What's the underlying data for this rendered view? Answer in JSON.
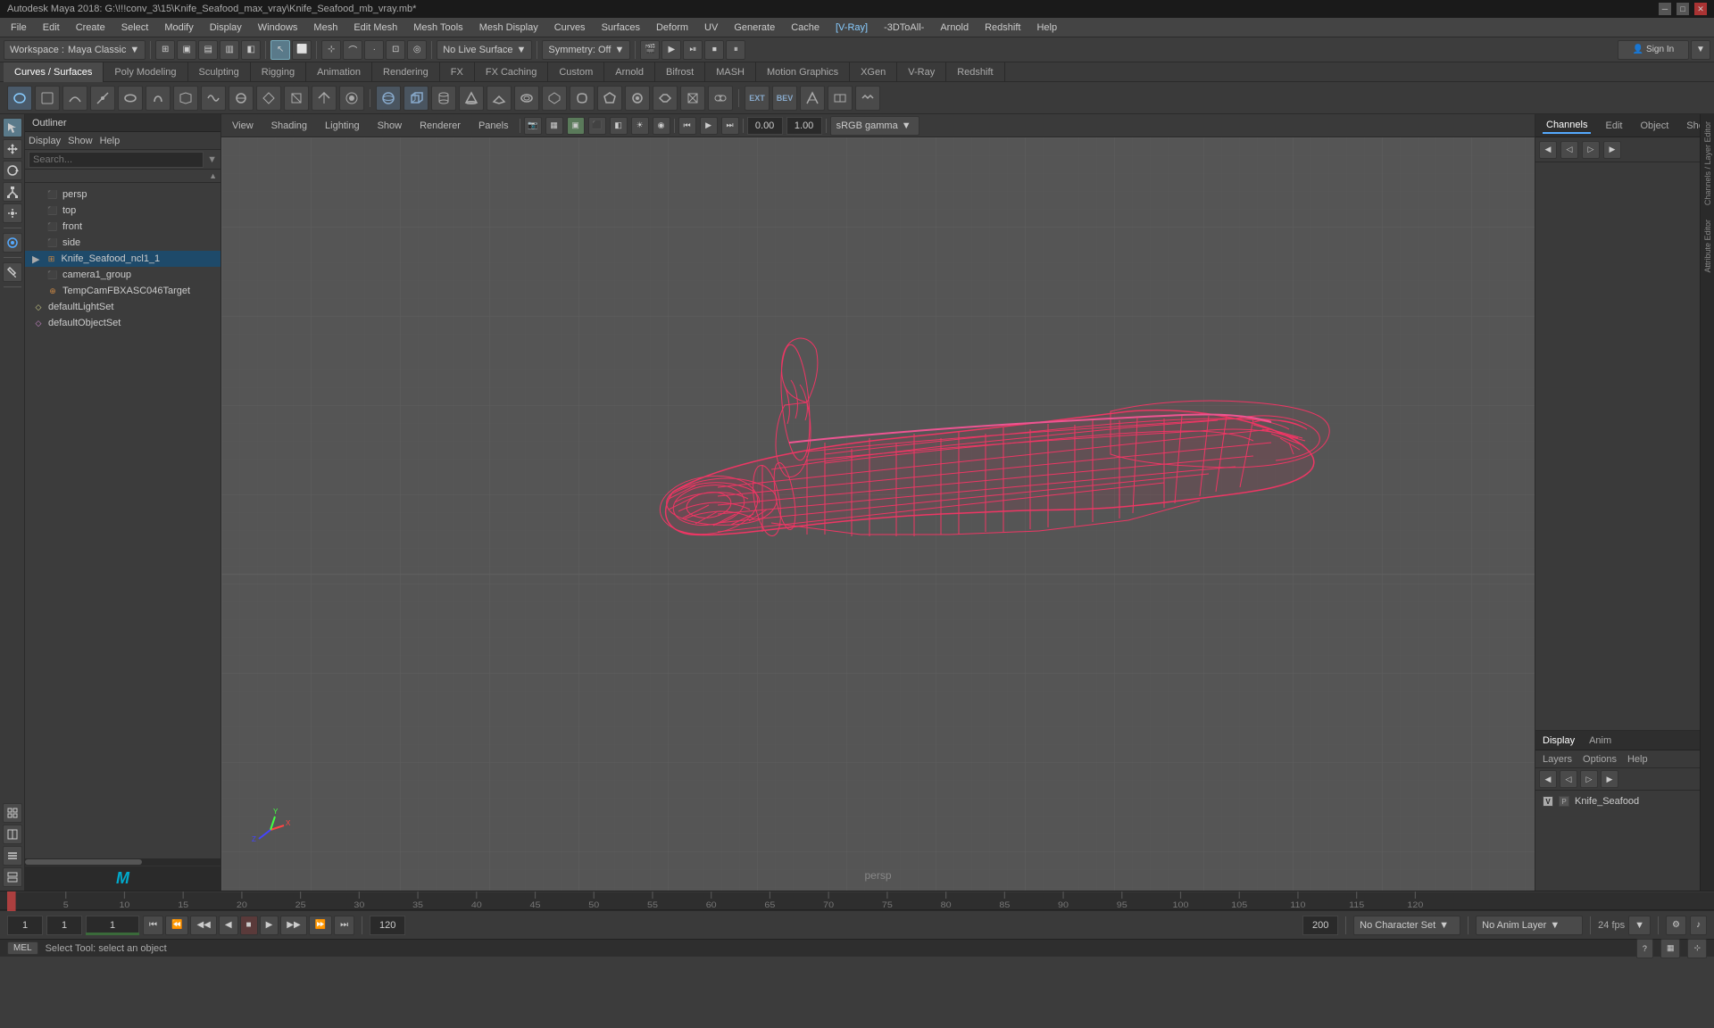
{
  "window": {
    "title": "Autodesk Maya 2018: G:\\!!!conv_3\\15\\Knife_Seafood_max_vray\\Knife_Seafood_mb_vray.mb*",
    "title_short": "Autodesk Maya 2018: G:\\!!!conv_3\\15\\Knife_Seafood_max_vray\\Knife_Seafood_mb_vray.mb*"
  },
  "menu_bar": {
    "items": [
      "File",
      "Edit",
      "Create",
      "Select",
      "Modify",
      "Display",
      "Windows",
      "Mesh",
      "Edit Mesh",
      "Mesh Tools",
      "Mesh Display",
      "Curves",
      "Surfaces",
      "Deform",
      "UV",
      "Generate",
      "Cache",
      "[V-Ray]",
      "-3DToAll-",
      "Arnold",
      "Redshift",
      "Help"
    ]
  },
  "toolbar1": {
    "workspace_label": "Workspace :",
    "workspace_value": "Maya Classic",
    "live_surface": "No Live Surface",
    "symmetry": "Symmetry: Off"
  },
  "tabs": {
    "items": [
      "Curves / Surfaces",
      "Poly Modeling",
      "Sculpting",
      "Rigging",
      "Animation",
      "Rendering",
      "FX",
      "FX Caching",
      "Custom",
      "Arnold",
      "Bifrost",
      "MASH",
      "Motion Graphics",
      "XGen",
      "V-Ray",
      "Redshift"
    ]
  },
  "outliner": {
    "title": "Outliner",
    "menu": [
      "Display",
      "Show",
      "Help"
    ],
    "search_placeholder": "Search...",
    "tree_items": [
      {
        "label": "persp",
        "type": "camera",
        "indent": 1
      },
      {
        "label": "top",
        "type": "camera",
        "indent": 1
      },
      {
        "label": "front",
        "type": "camera",
        "indent": 1
      },
      {
        "label": "side",
        "type": "camera",
        "indent": 1
      },
      {
        "label": "Knife_Seafood_ncl1_1",
        "type": "mesh",
        "indent": 0
      },
      {
        "label": "camera1_group",
        "type": "camera",
        "indent": 1
      },
      {
        "label": "TempCamFBXASC046Target",
        "type": "camera",
        "indent": 1
      },
      {
        "label": "defaultLightSet",
        "type": "light",
        "indent": 0
      },
      {
        "label": "defaultObjectSet",
        "type": "set",
        "indent": 0
      }
    ]
  },
  "viewport": {
    "camera": "persp",
    "menus": [
      "View",
      "Shading",
      "Lighting",
      "Show",
      "Renderer",
      "Panels"
    ],
    "gamma_label": "sRGB gamma",
    "value1": "0.00",
    "value2": "1.00"
  },
  "right_panel": {
    "tabs": [
      "Channels",
      "Edit",
      "Object",
      "Show"
    ],
    "display_tabs": [
      "Display",
      "Anim"
    ],
    "display_submenu": [
      "Layers",
      "Options",
      "Help"
    ],
    "layer_item": "Knife_Seafood"
  },
  "timeline": {
    "ticks": [
      "5",
      "10",
      "15",
      "20",
      "25",
      "30",
      "35",
      "40",
      "45",
      "50",
      "55",
      "60",
      "65",
      "70",
      "75",
      "80",
      "85",
      "90",
      "95",
      "100",
      "105",
      "110",
      "115",
      "120"
    ],
    "start": "1",
    "end": "120",
    "range_end": "200"
  },
  "bottom_toolbar": {
    "frame_start": "1",
    "frame_current": "1",
    "frame_display": "1",
    "range_start": "1",
    "range_end": "120",
    "anim_end": "200",
    "character_set": "No Character Set",
    "anim_layer": "No Anim Layer",
    "fps": "24 fps"
  },
  "status_bar": {
    "mel_label": "MEL",
    "status_text": "Select Tool: select an object"
  },
  "viewport_left_tools": {
    "tools": [
      "▶",
      "⬛",
      "↔",
      "⟲",
      "⤢",
      "·",
      "◎",
      "✦"
    ],
    "tools2": [
      "▦",
      "⊞",
      "≡",
      "▤"
    ]
  }
}
